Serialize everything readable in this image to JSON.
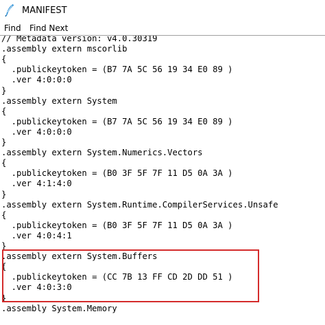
{
  "window": {
    "title": "MANIFEST"
  },
  "menu": {
    "items": [
      "Find",
      "Find Next"
    ]
  },
  "code": {
    "lines": [
      "// Metadata version: v4.0.30319",
      ".assembly extern mscorlib",
      "{",
      "  .publickeytoken = (B7 7A 5C 56 19 34 E0 89 )",
      "  .ver 4:0:0:0",
      "}",
      ".assembly extern System",
      "{",
      "  .publickeytoken = (B7 7A 5C 56 19 34 E0 89 )",
      "  .ver 4:0:0:0",
      "}",
      ".assembly extern System.Numerics.Vectors",
      "{",
      "  .publickeytoken = (B0 3F 5F 7F 11 D5 0A 3A )",
      "  .ver 4:1:4:0",
      "}",
      ".assembly extern System.Runtime.CompilerServices.Unsafe",
      "{",
      "  .publickeytoken = (B0 3F 5F 7F 11 D5 0A 3A )",
      "  .ver 4:0:4:1",
      "}",
      ".assembly extern System.Buffers",
      "{",
      "  .publickeytoken = (CC 7B 13 FF CD 2D DD 51 )",
      "  .ver 4:0:3:0",
      "}",
      ".assembly System.Memory"
    ]
  },
  "highlight": {
    "color": "#d42b2b",
    "target": ".assembly extern System.Buffers"
  },
  "icons": {
    "app": "feather-quill-icon"
  }
}
